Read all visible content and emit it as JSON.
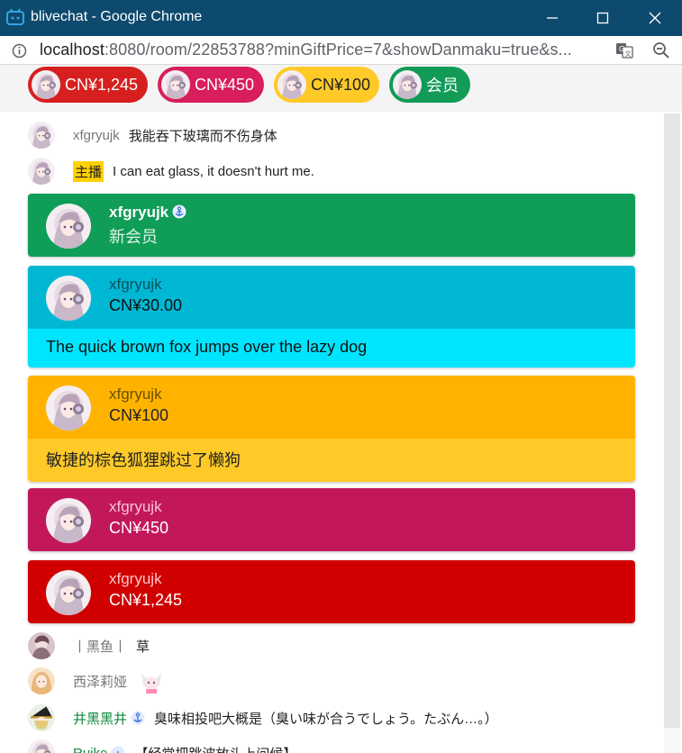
{
  "window": {
    "title": "blivechat - Google Chrome"
  },
  "address": {
    "host": "localhost",
    "rest": ":8080/room/22853788?minGiftPrice=7&showDanmaku=true&s..."
  },
  "ticker": [
    {
      "label": "CN¥1,245",
      "color": "#d71f1f"
    },
    {
      "label": "CN¥450",
      "color": "#d81e5b"
    },
    {
      "label": "CN¥100",
      "color": "#ffca28"
    },
    {
      "label": "会员",
      "color": "#119b57"
    }
  ],
  "messages": {
    "m1": {
      "name": "xfgryujk",
      "text": "我能吞下玻璃而不伤身体"
    },
    "m2": {
      "badge": "主播",
      "text": "I can eat glass, it doesn't hurt me."
    },
    "m3": {
      "name": "丨黑鱼丨",
      "text": "草"
    },
    "m4": {
      "name": "西泽莉娅"
    },
    "m5": {
      "name": "井黑黑井",
      "text": "臭味相投吧大概是（臭い味が合うでしょう。たぶん…。）"
    },
    "m6": {
      "name": "Ruike",
      "text": "【经常把跳波放头上问候】"
    }
  },
  "cards": {
    "member": {
      "name": "xfgryujk",
      "amount": "新会员"
    },
    "c30": {
      "name": "xfgryujk",
      "amount": "CN¥30.00",
      "text": "The quick brown fox jumps over the lazy dog"
    },
    "c100": {
      "name": "xfgryujk",
      "amount": "CN¥100",
      "text": "敏捷的棕色狐狸跳过了懒狗"
    },
    "c450": {
      "name": "xfgryujk",
      "amount": "CN¥450"
    },
    "c1245": {
      "name": "xfgryujk",
      "amount": "CN¥1,245"
    }
  }
}
